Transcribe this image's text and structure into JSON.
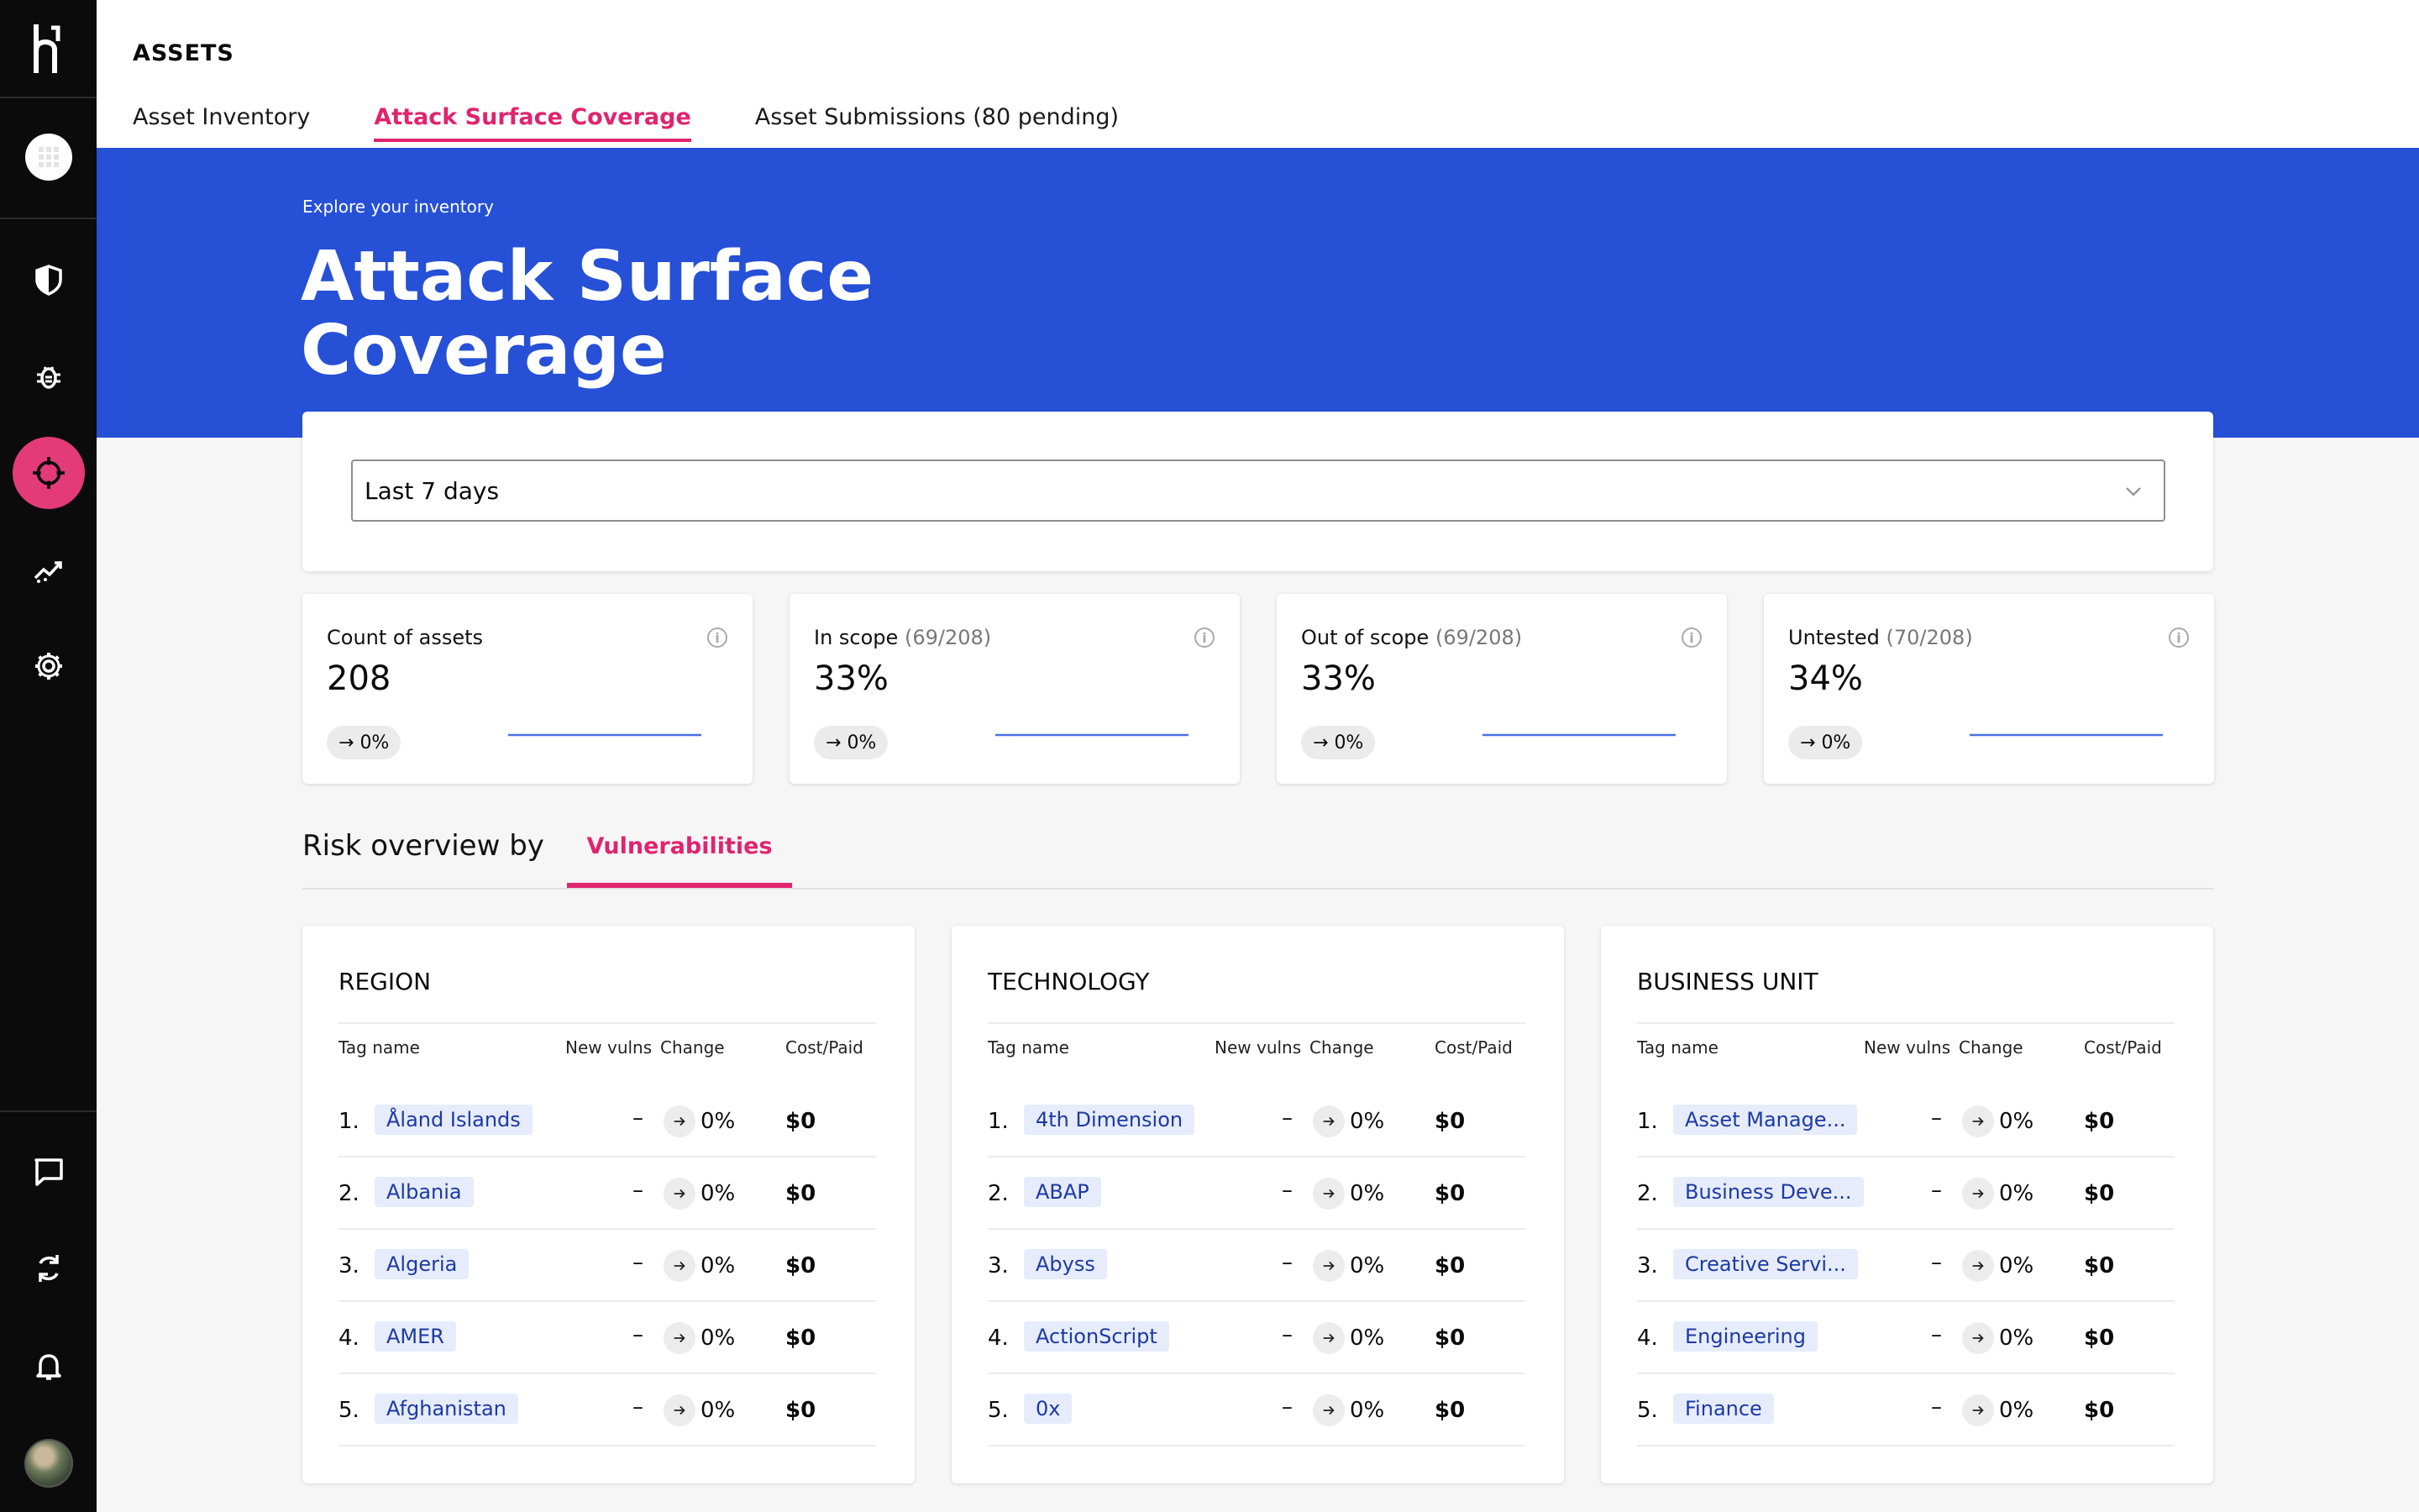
{
  "app": {
    "section_title": "ASSETS",
    "tabs": [
      {
        "label": "Asset Inventory"
      },
      {
        "label": "Attack Surface Coverage",
        "active": true
      },
      {
        "label": "Asset Submissions (80 pending)"
      }
    ],
    "colors": {
      "accent": "#e0246f",
      "hero": "#2650d6",
      "sidebar": "#0b0b0b",
      "tag_bg": "#e6ecfb",
      "sparkline": "#2650d6"
    }
  },
  "sidebar": {
    "icons": [
      "logo-icon",
      "grid-icon",
      "shield-icon",
      "bug-icon",
      "crosshair-icon",
      "analytics-icon",
      "gear-icon",
      "chat-icon",
      "sync-icon",
      "bell-icon",
      "avatar"
    ],
    "active": "crosshair-icon"
  },
  "hero": {
    "eyebrow": "Explore your inventory",
    "title": "Attack Surface Coverage"
  },
  "filter": {
    "selected": "Last 7 days"
  },
  "metrics": [
    {
      "label": "Count of assets",
      "sub": "",
      "value": "208",
      "change": "0%"
    },
    {
      "label": "In scope",
      "sub": "(69/208)",
      "value": "33%",
      "change": "0%"
    },
    {
      "label": "Out of scope",
      "sub": "(69/208)",
      "value": "33%",
      "change": "0%"
    },
    {
      "label": "Untested",
      "sub": "(70/208)",
      "value": "34%",
      "change": "0%"
    }
  ],
  "risk": {
    "label": "Risk overview by",
    "tab": "Vulnerabilities"
  },
  "columns": {
    "tag": "Tag name",
    "new": "New vulns",
    "change": "Change",
    "cost": "Cost/Paid"
  },
  "tables": [
    {
      "title": "REGION",
      "rows": [
        {
          "rank": "1.",
          "tag": "Åland Islands",
          "new": "–",
          "change": "0%",
          "cost": "$0"
        },
        {
          "rank": "2.",
          "tag": "Albania",
          "new": "–",
          "change": "0%",
          "cost": "$0"
        },
        {
          "rank": "3.",
          "tag": "Algeria",
          "new": "–",
          "change": "0%",
          "cost": "$0"
        },
        {
          "rank": "4.",
          "tag": "AMER",
          "new": "–",
          "change": "0%",
          "cost": "$0"
        },
        {
          "rank": "5.",
          "tag": "Afghanistan",
          "new": "–",
          "change": "0%",
          "cost": "$0"
        }
      ]
    },
    {
      "title": "TECHNOLOGY",
      "rows": [
        {
          "rank": "1.",
          "tag": "4th Dimension",
          "new": "–",
          "change": "0%",
          "cost": "$0"
        },
        {
          "rank": "2.",
          "tag": "ABAP",
          "new": "–",
          "change": "0%",
          "cost": "$0"
        },
        {
          "rank": "3.",
          "tag": "Abyss",
          "new": "–",
          "change": "0%",
          "cost": "$0"
        },
        {
          "rank": "4.",
          "tag": "ActionScript",
          "new": "–",
          "change": "0%",
          "cost": "$0"
        },
        {
          "rank": "5.",
          "tag": "0x",
          "new": "–",
          "change": "0%",
          "cost": "$0"
        }
      ]
    },
    {
      "title": "BUSINESS UNIT",
      "rows": [
        {
          "rank": "1.",
          "tag": "Asset Manage...",
          "new": "–",
          "change": "0%",
          "cost": "$0"
        },
        {
          "rank": "2.",
          "tag": "Business Deve...",
          "new": "–",
          "change": "0%",
          "cost": "$0"
        },
        {
          "rank": "3.",
          "tag": "Creative Servi...",
          "new": "–",
          "change": "0%",
          "cost": "$0"
        },
        {
          "rank": "4.",
          "tag": "Engineering",
          "new": "–",
          "change": "0%",
          "cost": "$0"
        },
        {
          "rank": "5.",
          "tag": "Finance",
          "new": "–",
          "change": "0%",
          "cost": "$0"
        }
      ]
    }
  ]
}
